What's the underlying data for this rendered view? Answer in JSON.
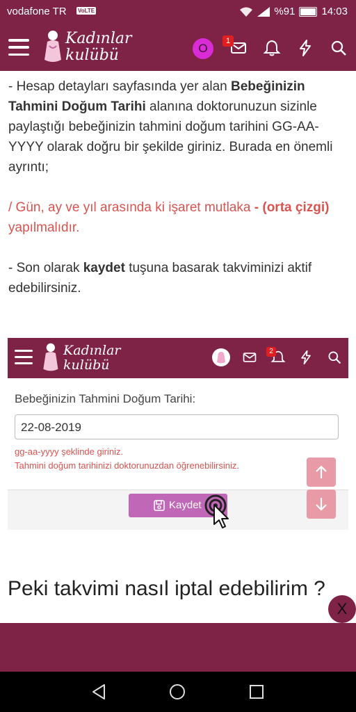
{
  "status_bar": {
    "carrier": "vodafone TR",
    "volte": "VoLTE",
    "battery": "%91",
    "time": "14:03"
  },
  "app_bar": {
    "logo_line1": "Kadınlar",
    "logo_line2": "kulübü",
    "avatar_letter": "O",
    "messages_badge": "1"
  },
  "content": {
    "p1_a": "- Hesap detayları sayfasında yer alan ",
    "p1_bold": "Bebeğinizin Tahmini Doğum Tarihi",
    "p1_b": " alanına doktorunuzun sizinle paylaştığı bebeğinizin tahmini doğum tarihini GG-AA-YYYY olarak doğru bir şekilde giriniz. Burada en önemli ayrıntı;",
    "p2_a": "/ Gün, ay ve yıl arasında ki işaret mutlaka ",
    "p2_bold": "- (orta çizgi)",
    "p2_b": " yapılmalıdır.",
    "p3_a": "- Son olarak ",
    "p3_bold": "kaydet",
    "p3_b": " tuşuna basarak takviminizi aktif edebilirsiniz."
  },
  "embedded_screenshot": {
    "logo_line1": "Kadınlar",
    "logo_line2": "kulübü",
    "notification_badge": "2",
    "field_label": "Bebeğinizin Tahmini Doğum Tarihi:",
    "field_value": "22-08-2019",
    "hint1": "gg-aa-yyyy şeklinde giriniz.",
    "hint2": "Tahmini doğum tarihinizi doktorunuzdan öğrenebilirsiniz.",
    "save_label": "Kaydet"
  },
  "heading": "Peki takvimi nasıl iptal edebilirim ?",
  "close_label": "X",
  "colors": {
    "brand": "#7f2346",
    "accent_red": "#d9534f",
    "save_button": "#c167b8"
  },
  "icons": [
    "hamburger-icon",
    "mail-icon",
    "bell-icon",
    "bolt-icon",
    "search-icon",
    "save-disk-icon",
    "arrow-up-icon",
    "arrow-down-icon",
    "cursor-pointer-icon",
    "back-icon",
    "home-icon",
    "recents-icon"
  ]
}
